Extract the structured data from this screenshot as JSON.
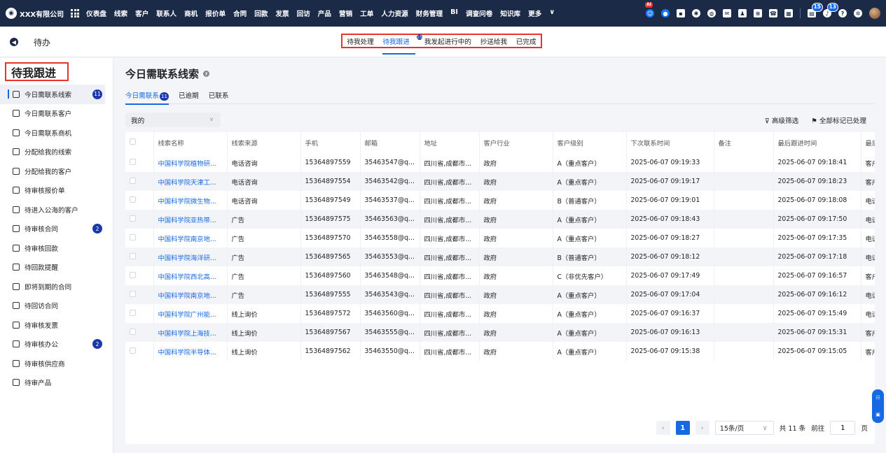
{
  "brand": {
    "name": "XXX有限公司"
  },
  "top_menu": [
    "仪表盘",
    "线索",
    "客户",
    "联系人",
    "商机",
    "报价单",
    "合同",
    "回款",
    "发票",
    "回访",
    "产品",
    "营销",
    "工单",
    "人力资源",
    "财务管理",
    "BI",
    "调查问卷",
    "知识库",
    "更多"
  ],
  "top_icons": {
    "ai_label": "AI",
    "task_badge": "15",
    "bell_badge": "13"
  },
  "subbar": {
    "title": "待办",
    "tabs": [
      {
        "label": "待我处理",
        "badge": ""
      },
      {
        "label": "待我跟进",
        "badge": "15"
      },
      {
        "label": "我发起进行中的",
        "badge": ""
      },
      {
        "label": "抄送给我",
        "badge": ""
      },
      {
        "label": "已完成",
        "badge": ""
      }
    ]
  },
  "sidebar": {
    "title": "待我跟进",
    "items": [
      {
        "label": "今日需联系线索",
        "count": "11"
      },
      {
        "label": "今日需联系客户",
        "count": ""
      },
      {
        "label": "今日需联系商机",
        "count": ""
      },
      {
        "label": "分配给我的线索",
        "count": ""
      },
      {
        "label": "分配给我的客户",
        "count": ""
      },
      {
        "label": "待审核报价单",
        "count": ""
      },
      {
        "label": "待进入公海的客户",
        "count": ""
      },
      {
        "label": "待审核合同",
        "count": "2"
      },
      {
        "label": "待审核回款",
        "count": ""
      },
      {
        "label": "待回款提醒",
        "count": ""
      },
      {
        "label": "即将到期的合同",
        "count": ""
      },
      {
        "label": "待回访合同",
        "count": ""
      },
      {
        "label": "待审核发票",
        "count": ""
      },
      {
        "label": "待审核办公",
        "count": "2"
      },
      {
        "label": "待审核供应商",
        "count": ""
      },
      {
        "label": "待审产品",
        "count": ""
      }
    ]
  },
  "main": {
    "title": "今日需联系线索",
    "subtabs": [
      {
        "label": "今日需联系",
        "badge": "11"
      },
      {
        "label": "已逾期",
        "badge": ""
      },
      {
        "label": "已联系",
        "badge": ""
      }
    ],
    "filter_value": "我的",
    "actions": {
      "advanced_filter": "高级筛选",
      "mark_all": "全部标记已处理"
    }
  },
  "table": {
    "headers": [
      "线索名称",
      "线索来源",
      "手机",
      "邮箱",
      "地址",
      "客户行业",
      "客户级别",
      "下次联系时间",
      "备注",
      "最后跟进时间",
      "最后"
    ],
    "rows": [
      [
        "中国科学院植物研...",
        "电话咨询",
        "15364897559",
        "35463547@q...",
        "四川省,成都市...",
        "政府",
        "A（重点客户）",
        "2025-06-07 09:19:33",
        "",
        "2025-06-07 09:18:41",
        "客户"
      ],
      [
        "中国科学院天津工...",
        "电话咨询",
        "15364897554",
        "35463542@q...",
        "四川省,成都市...",
        "政府",
        "A（重点客户）",
        "2025-06-07 09:19:17",
        "",
        "2025-06-07 09:18:23",
        "客户"
      ],
      [
        "中国科学院微生物...",
        "电话咨询",
        "15364897549",
        "35463537@q...",
        "四川省,成都市...",
        "政府",
        "B（普通客户）",
        "2025-06-07 09:19:01",
        "",
        "2025-06-07 09:18:08",
        "电话"
      ],
      [
        "中国科学院亚热带...",
        "广告",
        "15364897575",
        "35463563@q...",
        "四川省,成都市...",
        "政府",
        "A（重点客户）",
        "2025-06-07 09:18:43",
        "",
        "2025-06-07 09:17:50",
        "电话"
      ],
      [
        "中国科学院南京地...",
        "广告",
        "15364897570",
        "35463558@q...",
        "四川省,成都市...",
        "政府",
        "A（重点客户）",
        "2025-06-07 09:18:27",
        "",
        "2025-06-07 09:17:35",
        "电话"
      ],
      [
        "中国科学院海洋研...",
        "广告",
        "15364897565",
        "35463553@q...",
        "四川省,成都市...",
        "政府",
        "B（普通客户）",
        "2025-06-07 09:18:12",
        "",
        "2025-06-07 09:17:18",
        "电话"
      ],
      [
        "中国科学院西北高...",
        "广告",
        "15364897560",
        "35463548@q...",
        "四川省,成都市...",
        "政府",
        "C（非优先客户）",
        "2025-06-07 09:17:49",
        "",
        "2025-06-07 09:16:57",
        "客户"
      ],
      [
        "中国科学院南京地...",
        "广告",
        "15364897555",
        "35463543@q...",
        "四川省,成都市...",
        "政府",
        "A（重点客户）",
        "2025-06-07 09:17:04",
        "",
        "2025-06-07 09:16:12",
        "电话"
      ],
      [
        "中国科学院广州能...",
        "线上询价",
        "15364897572",
        "35463560@q...",
        "四川省,成都市...",
        "政府",
        "A（重点客户）",
        "2025-06-07 09:16:37",
        "",
        "2025-06-07 09:15:49",
        "电话"
      ],
      [
        "中国科学院上海技...",
        "线上询价",
        "15364897567",
        "35463555@q...",
        "四川省,成都市...",
        "政府",
        "A（重点客户）",
        "2025-06-07 09:16:13",
        "",
        "2025-06-07 09:15:31",
        "客户"
      ],
      [
        "中国科学院半导体...",
        "线上询价",
        "15364897562",
        "35463550@q...",
        "四川省,成都市...",
        "政府",
        "A（重点客户）",
        "2025-06-07 09:15:38",
        "",
        "2025-06-07 09:15:05",
        "客户"
      ]
    ]
  },
  "pagination": {
    "current": "1",
    "page_size": "15条/页",
    "total": "共 11 条",
    "goto_label": "前往",
    "goto_value": "1",
    "page_suffix": "页"
  },
  "colors": {
    "nav_bg": "#1b2a47",
    "accent": "#1668e3",
    "highlight_border": "#e8342d"
  }
}
